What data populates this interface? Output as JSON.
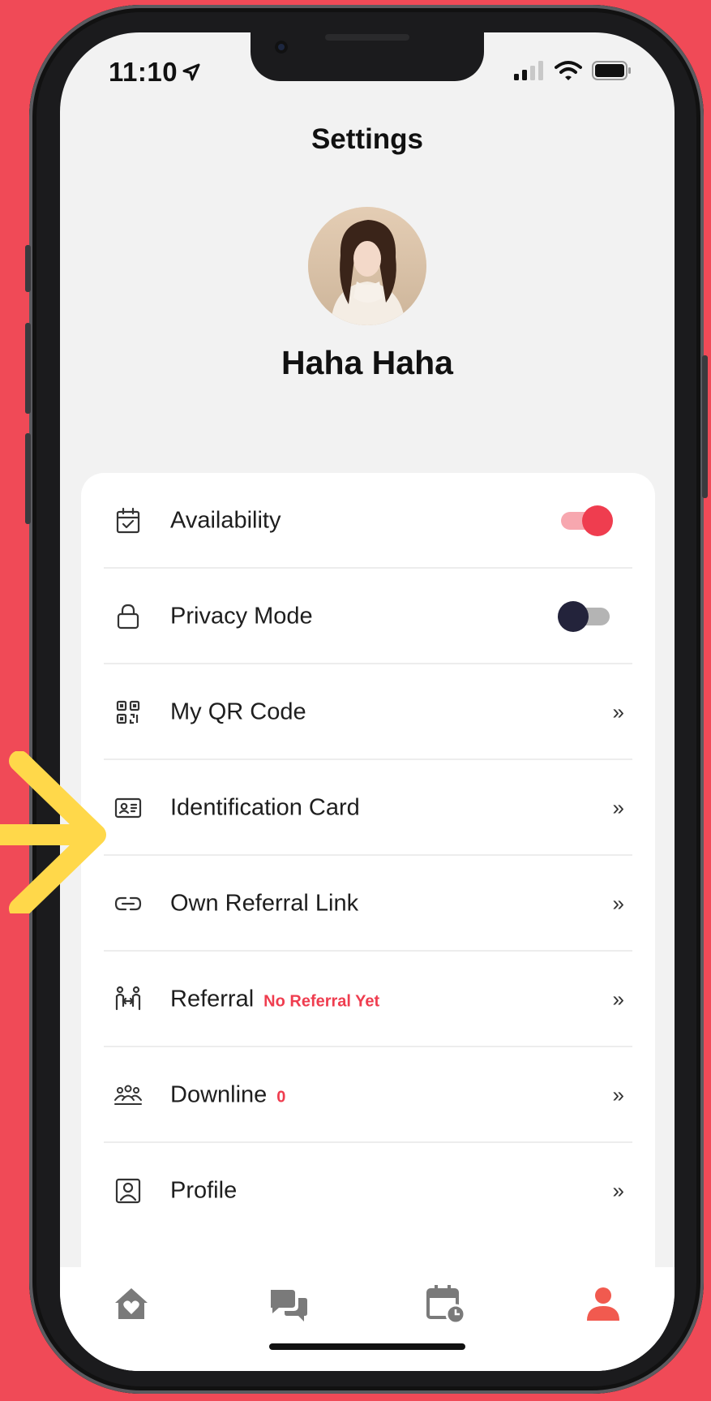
{
  "status_bar": {
    "time": "11:10"
  },
  "header": {
    "title": "Settings"
  },
  "profile": {
    "name": "Haha Haha"
  },
  "settings": [
    {
      "label": "Availability",
      "icon": "calendar-check-icon",
      "control": "toggle",
      "toggle_on": true
    },
    {
      "label": "Privacy Mode",
      "icon": "lock-icon",
      "control": "toggle",
      "toggle_on": false
    },
    {
      "label": "My QR Code",
      "icon": "qr-code-icon",
      "control": "chevron"
    },
    {
      "label": "Identification Card",
      "icon": "id-card-icon",
      "control": "chevron"
    },
    {
      "label": "Own Referral Link",
      "icon": "link-icon",
      "control": "chevron"
    },
    {
      "label": "Referral",
      "icon": "referral-icon",
      "control": "chevron",
      "badge": "No Referral Yet"
    },
    {
      "label": "Downline",
      "icon": "group-icon",
      "control": "chevron",
      "badge": "0"
    },
    {
      "label": "Profile",
      "icon": "profile-icon",
      "control": "chevron"
    }
  ],
  "chevron_text": "»",
  "tabs": [
    {
      "name": "home",
      "icon": "home-heart-icon",
      "active": false
    },
    {
      "name": "chat",
      "icon": "chat-icon",
      "active": false
    },
    {
      "name": "schedule",
      "icon": "calendar-clock-icon",
      "active": false
    },
    {
      "name": "account",
      "icon": "person-icon",
      "active": true
    }
  ],
  "colors": {
    "background": "#f04a57",
    "accent": "#ef3d4f",
    "arrow": "#ffd84a",
    "tab_inactive": "#7a7a7a"
  }
}
